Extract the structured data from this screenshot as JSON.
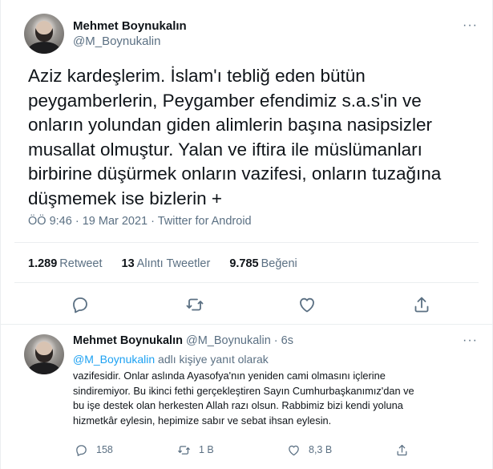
{
  "main_tweet": {
    "author_name": "Mehmet Boynukalın",
    "author_handle": "@M_Boynukalin",
    "more_label": "···",
    "text": "Aziz kardeşlerim. İslam'ı tebliğ eden bütün\npeygamberlerin, Peygamber efendimiz s.a.s'in ve\nonların yolundan giden alimlerin başına nasipsizler\nmusallat olmuştur. Yalan ve iftira ile müslümanları\nbirbirine düşürmek onların vazifesi, onların tuzağına\ndüşmemek ise bizlerin +",
    "time": "ÖÖ 9:46",
    "separator": " · ",
    "date": "19 Mar 2021",
    "source": "Twitter for Android",
    "stats": {
      "retweets_count": "1.289",
      "retweets_label": "Retweet",
      "quotes_count": "13",
      "quotes_label": "Alıntı Tweetler",
      "likes_count": "9.785",
      "likes_label": "Beğeni"
    },
    "actions": [
      "reply-icon",
      "retweet-icon",
      "like-icon",
      "share-icon"
    ]
  },
  "reply_tweet": {
    "author_name": "Mehmet Boynukalın",
    "author_handle": "@M_Boynukalin",
    "time_sep": " · ",
    "time": "6s",
    "more_label": "···",
    "reply_mention": "@M_Boynukalin",
    "reply_suffix": " adlı kişiye yanıt olarak",
    "text": "vazifesidir. Onlar aslında Ayasofya'nın yeniden cami olmasını içlerine\nsindiremiyor. Bu ikinci fethi gerçekleştiren Sayın Cumhurbaşkanımız'dan ve\nbu işe destek olan herkesten Allah razı olsun. Rabbimiz bizi kendi yoluna\nhizmetkâr eylesin, hepimize sabır ve sebat ihsan eylesin.",
    "reply_count": "158",
    "retweet_count": "1 B",
    "like_count": "8,3 B"
  },
  "colors": {
    "text": "#0f1419",
    "secondary": "#5b7083",
    "accent": "#1da1f2",
    "divider": "#ebeef0"
  }
}
